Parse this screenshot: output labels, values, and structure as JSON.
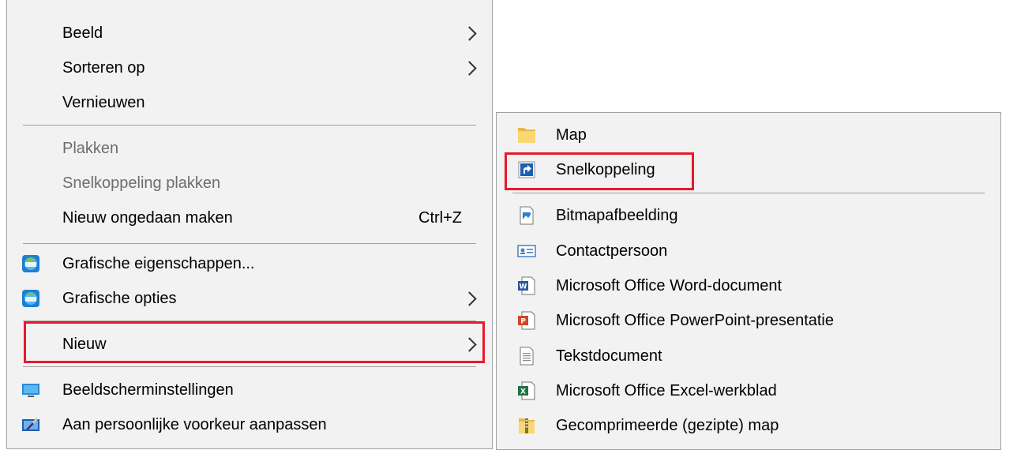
{
  "main_menu": {
    "items": [
      {
        "label": "Beeld"
      },
      {
        "label": "Sorteren op"
      },
      {
        "label": "Vernieuwen"
      },
      {
        "label": "Plakken"
      },
      {
        "label": "Snelkoppeling plakken"
      },
      {
        "label": "Nieuw ongedaan maken",
        "shortcut": "Ctrl+Z"
      },
      {
        "label": "Grafische eigenschappen...",
        "icon": "intel-graphics-icon"
      },
      {
        "label": "Grafische opties",
        "icon": "intel-graphics-icon"
      },
      {
        "label": "Nieuw"
      },
      {
        "label": "Beeldscherminstellingen",
        "icon": "monitor-icon"
      },
      {
        "label": "Aan persoonlijke voorkeur aanpassen",
        "icon": "personalize-icon"
      }
    ]
  },
  "sub_menu": {
    "items": [
      {
        "label": "Map",
        "icon": "folder-icon"
      },
      {
        "label": "Snelkoppeling",
        "icon": "shortcut-icon"
      },
      {
        "label": "Bitmapafbeelding",
        "icon": "bitmap-icon"
      },
      {
        "label": "Contactpersoon",
        "icon": "contact-icon"
      },
      {
        "label": "Microsoft Office Word-document",
        "icon": "word-icon"
      },
      {
        "label": "Microsoft Office PowerPoint-presentatie",
        "icon": "powerpoint-icon"
      },
      {
        "label": "Tekstdocument",
        "icon": "text-document-icon"
      },
      {
        "label": "Microsoft Office Excel-werkblad",
        "icon": "excel-icon"
      },
      {
        "label": "Gecomprimeerde (gezipte) map",
        "icon": "zip-folder-icon"
      }
    ]
  },
  "colors": {
    "highlight": "#e8192c",
    "menu_bg": "#f2f2f2",
    "disabled_text": "#6d6d6d"
  }
}
